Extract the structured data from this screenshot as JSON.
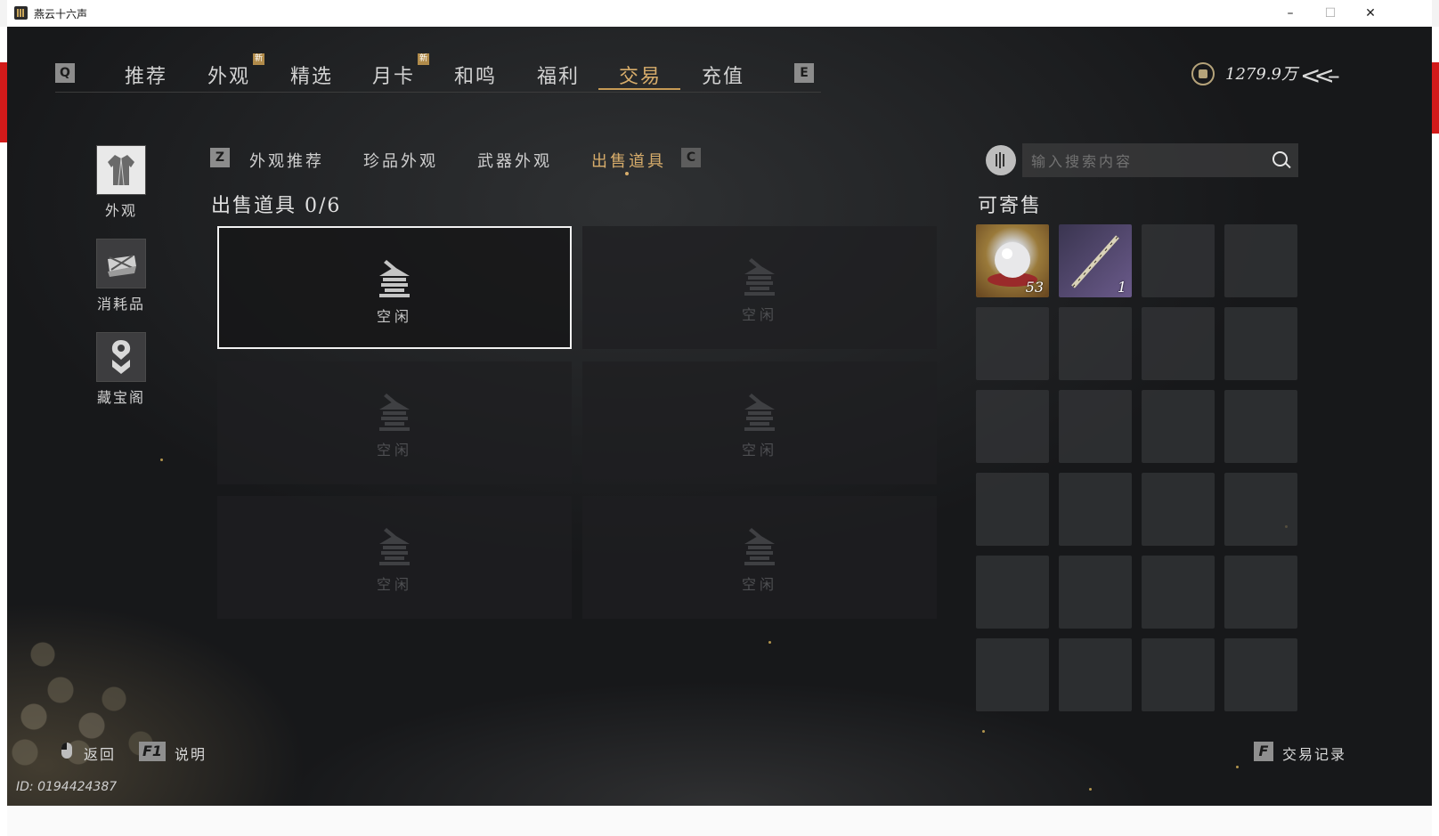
{
  "window": {
    "title": "燕云十六声",
    "minimize": "–",
    "maximize": "☐",
    "close": "✕"
  },
  "nav": {
    "key_left": "Q",
    "key_right": "E",
    "tabs": [
      {
        "label": "推荐"
      },
      {
        "label": "外观",
        "badge": "新"
      },
      {
        "label": "精选"
      },
      {
        "label": "月卡",
        "badge": "新"
      },
      {
        "label": "和鸣"
      },
      {
        "label": "福利"
      },
      {
        "label": "交易"
      },
      {
        "label": "充值"
      }
    ],
    "active_tab": "交易"
  },
  "currency": {
    "icon": "coin-icon",
    "value": "1279.9万"
  },
  "sidebar": {
    "items": [
      {
        "label": "外观",
        "icon": "outfit-icon"
      },
      {
        "label": "消耗品",
        "icon": "consumable-icon"
      },
      {
        "label": "藏宝阁",
        "icon": "treasure-pavilion-icon"
      }
    ],
    "active": "外观"
  },
  "subtabs": {
    "key_left": "Z",
    "key_right": "C",
    "items": [
      {
        "label": "外观推荐"
      },
      {
        "label": "珍品外观"
      },
      {
        "label": "武器外观"
      },
      {
        "label": "出售道具"
      }
    ],
    "active": "出售道具"
  },
  "sell_section": {
    "title": "出售道具 0/6",
    "slots": [
      {
        "label": "空闲"
      },
      {
        "label": "空闲"
      },
      {
        "label": "空闲"
      },
      {
        "label": "空闲"
      },
      {
        "label": "空闲"
      },
      {
        "label": "空闲"
      }
    ]
  },
  "search": {
    "placeholder": "输入搜索内容",
    "value": ""
  },
  "consign": {
    "title": "可寄售",
    "items": [
      {
        "name": "pearl",
        "qty": "53"
      },
      {
        "name": "flute-weapon",
        "qty": "1"
      }
    ],
    "empty_slots": 22
  },
  "footer": {
    "back_label": "返回",
    "help_key": "F1",
    "help_label": "说明",
    "record_key": "F",
    "record_label": "交易记录",
    "player_id": "ID: 0194424387"
  },
  "colors": {
    "accent": "#d8ad6b",
    "text": "#d2d2d2",
    "background": "#1c1d1f"
  }
}
